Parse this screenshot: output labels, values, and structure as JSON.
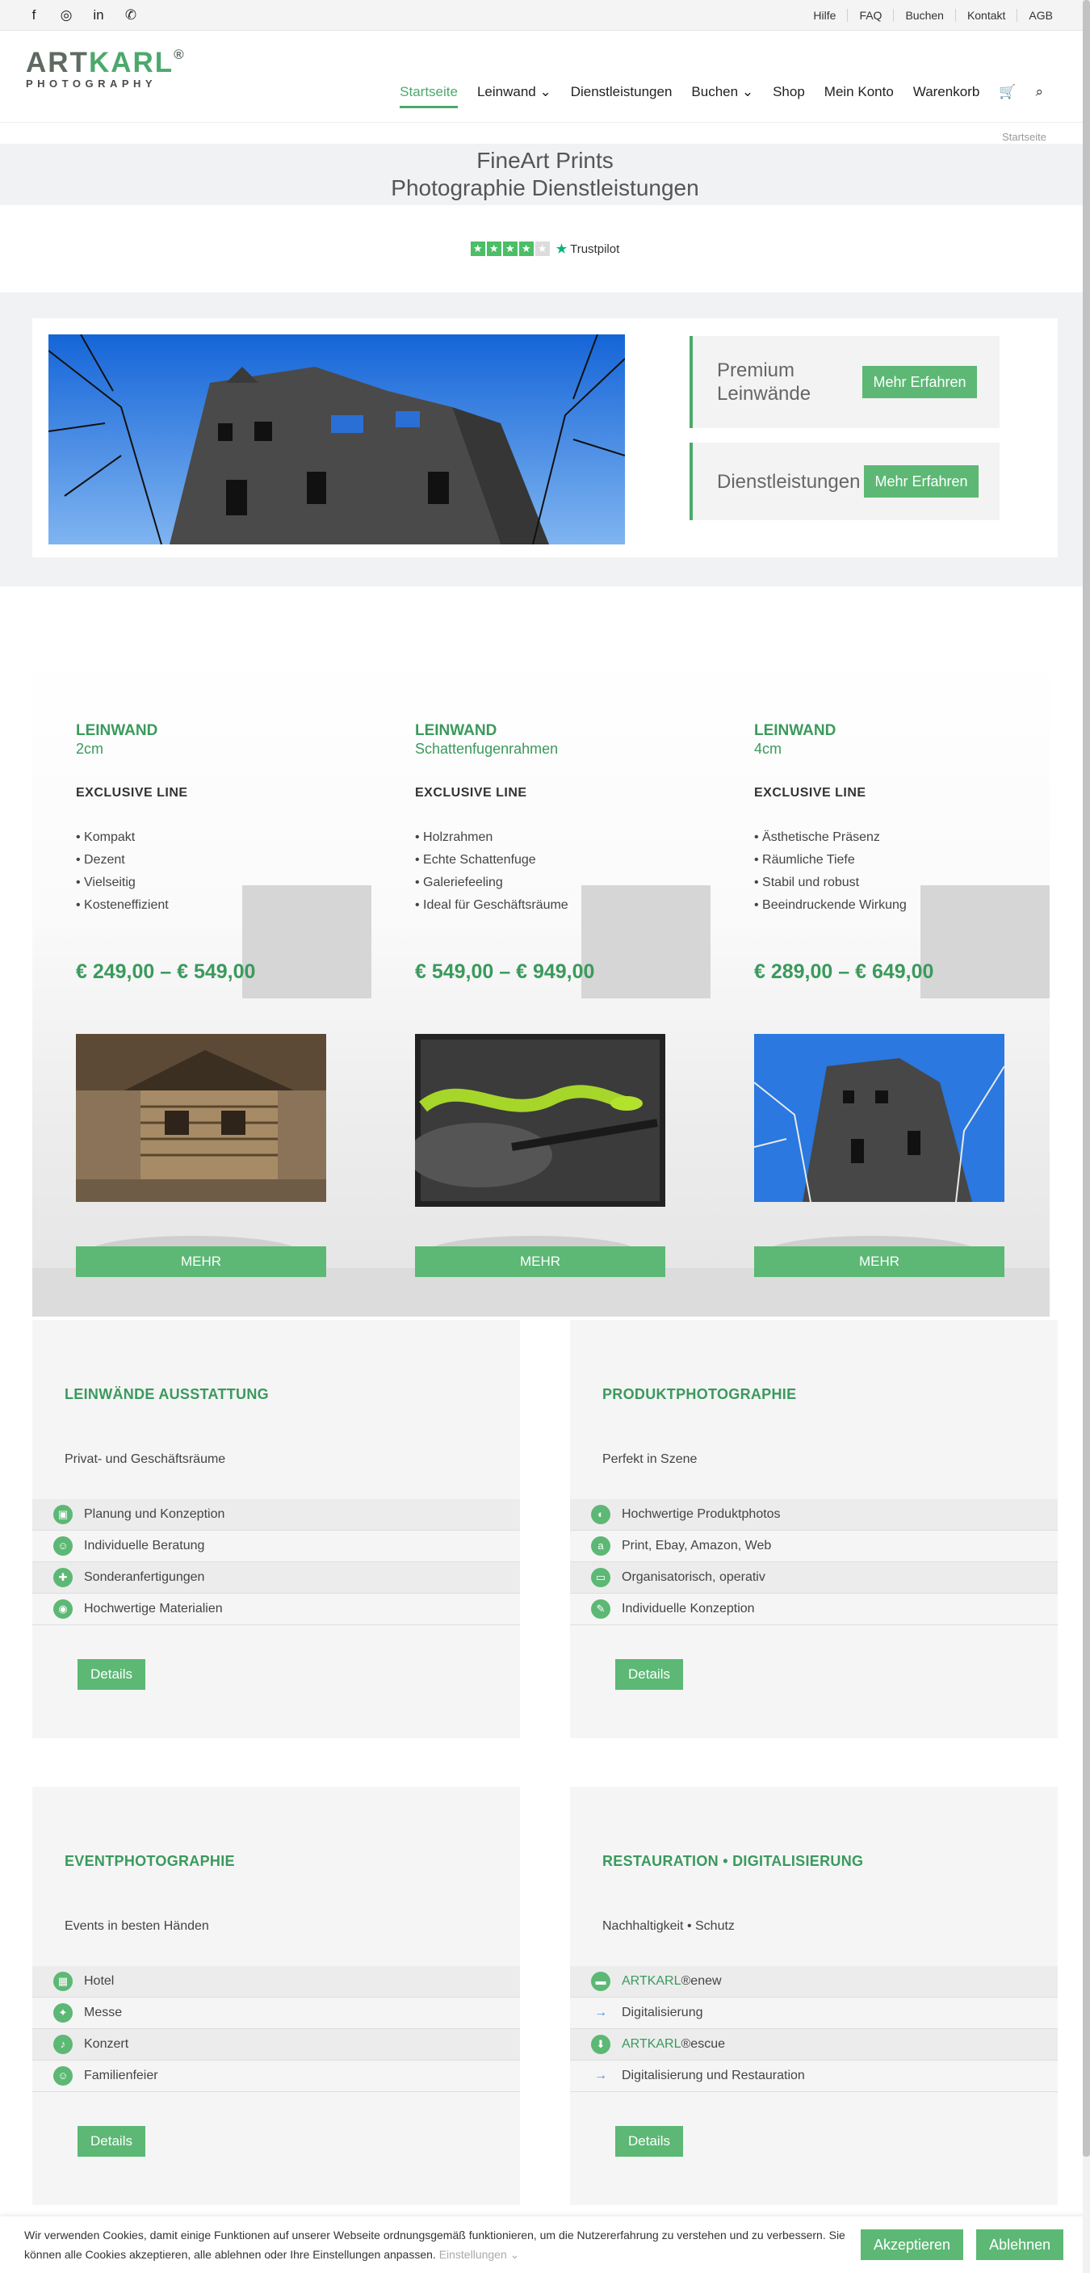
{
  "topbar": {
    "social": [
      "f",
      "◎",
      "in",
      "✆"
    ],
    "links": [
      "Hilfe",
      "FAQ",
      "Buchen",
      "Kontakt",
      "AGB"
    ]
  },
  "logo": {
    "brand_a": "ART",
    "brand_b": "KARL",
    "reg": "®",
    "sub": "PHOTOGRAPHY"
  },
  "nav": {
    "items": [
      "Startseite",
      "Leinwand",
      "Dienstleistungen",
      "Buchen",
      "Shop",
      "Mein Konto",
      "Warenkorb"
    ],
    "cart_icon": "🛒",
    "search_icon": "⌕",
    "chevron": "⌄"
  },
  "breadcrumb": "Startseite",
  "hero": {
    "line1": "FineArt Prints",
    "line2": "Photographie Dienstleistungen"
  },
  "trustpilot": {
    "label": "Trustpilot",
    "rating_stars": 4,
    "star_glyph": "★"
  },
  "promo": {
    "boxes": [
      {
        "title": "Premium Leinwände",
        "button": "Mehr Erfahren"
      },
      {
        "title": "Dienstleistungen",
        "button": "Mehr Erfahren"
      }
    ]
  },
  "products": [
    {
      "title": "LEINWAND",
      "subtitle": "2cm",
      "line": "EXCLUSIVE LINE",
      "features": [
        "• Kompakt",
        "• Dezent",
        "• Vielseitig",
        "• Kosteneffizient"
      ],
      "price": "€ 249,00 – € 549,00",
      "button": "MEHR"
    },
    {
      "title": "LEINWAND",
      "subtitle": "Schattenfugenrahmen",
      "line": "EXCLUSIVE LINE",
      "features": [
        "• Holzrahmen",
        "• Echte Schattenfuge",
        "• Galeriefeeling",
        "• Ideal für Geschäftsräume"
      ],
      "price": "€ 549,00 – € 949,00",
      "button": "MEHR"
    },
    {
      "title": "LEINWAND",
      "subtitle": "4cm",
      "line": "EXCLUSIVE LINE",
      "features": [
        "• Ästhetische Präsenz",
        "• Räumliche Tiefe",
        "• Stabil und robust",
        "• Beeindruckende Wirkung"
      ],
      "price": "€ 289,00 – € 649,00",
      "button": "MEHR"
    }
  ],
  "services": [
    {
      "title": "LEINWÄNDE AUSSTATTUNG",
      "lead": "Privat- und Geschäftsräume",
      "button": "Details",
      "items": [
        {
          "icon": "▣",
          "text": "Planung und Konzeption"
        },
        {
          "icon": "☺",
          "text": "Individuelle Beratung"
        },
        {
          "icon": "✚",
          "text": "Sonderanfertigungen"
        },
        {
          "icon": "◉",
          "text": "Hochwertige Materialien"
        }
      ]
    },
    {
      "title": "PRODUKTPHOTOGRAPHIE",
      "lead": "Perfekt in Szene",
      "button": "Details",
      "items": [
        {
          "icon": "◐",
          "text": "Hochwertige Produktphotos"
        },
        {
          "icon": "a",
          "text": "Print, Ebay, Amazon, Web"
        },
        {
          "icon": "▭",
          "text": "Organisatorisch, operativ"
        },
        {
          "icon": "✎",
          "text": "Individuelle Konzeption"
        }
      ]
    },
    {
      "title": "EVENTPHOTOGRAPHIE",
      "lead": "Events in besten Händen",
      "button": "Details",
      "items": [
        {
          "icon": "▦",
          "text": "Hotel"
        },
        {
          "icon": "✦",
          "text": "Messe"
        },
        {
          "icon": "♪",
          "text": "Konzert"
        },
        {
          "icon": "☺",
          "text": "Familienfeier"
        }
      ]
    },
    {
      "title": "RESTAURATION • DIGITALISIERUNG",
      "lead": "Nachhaltigkeit • Schutz",
      "button": "Details",
      "items": [
        {
          "icon": "▬",
          "brand": "ARTKARL",
          "text": "®enew"
        },
        {
          "arrow": "→",
          "text": "Digitalisierung"
        },
        {
          "icon": "⬇",
          "brand": "ARTKARL",
          "text": "®escue"
        },
        {
          "arrow": "→",
          "text": "Digitalisierung und Restauration"
        }
      ]
    }
  ],
  "cookie": {
    "text": "Wir verwenden Cookies, damit einige Funktionen auf unserer Webseite ordnungsgemäß funktionieren, um die Nutzererfahrung zu verstehen und zu verbessern. Sie können alle Cookies akzeptieren, alle ablehnen oder Ihre Einstellungen anpassen.",
    "settings": "Einstellungen ⌄",
    "accept": "Akzeptieren",
    "decline": "Ablehnen"
  }
}
